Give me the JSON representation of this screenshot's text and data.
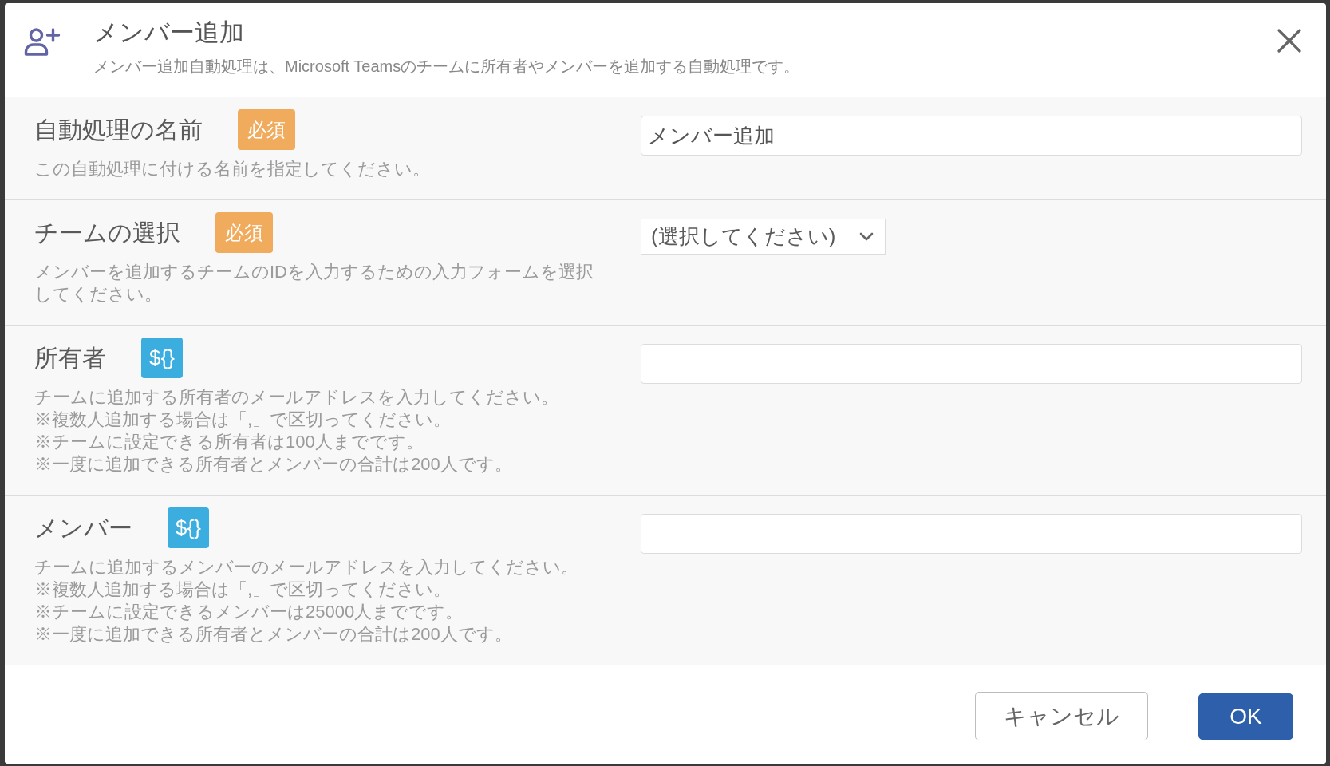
{
  "dialog": {
    "title": "メンバー追加",
    "description": "メンバー追加自動処理は、Microsoft Teamsのチームに所有者やメンバーを追加する自動処理です。"
  },
  "fields": [
    {
      "label": "自動処理の名前",
      "badge": {
        "kind": "required",
        "text": "必須"
      },
      "help": "この自動処理に付ける名前を指定してください。",
      "control": {
        "kind": "text",
        "value": "メンバー追加"
      }
    },
    {
      "label": "チームの選択",
      "badge": {
        "kind": "required",
        "text": "必須"
      },
      "help": "メンバーを追加するチームのIDを入力するための入力フォームを選択してください。",
      "control": {
        "kind": "select",
        "value": "(選択してください)"
      }
    },
    {
      "label": "所有者",
      "badge": {
        "kind": "variable",
        "text": "${}"
      },
      "help": "チームに追加する所有者のメールアドレスを入力してください。\n※複数人追加する場合は「,」で区切ってください。\n※チームに設定できる所有者は100人までです。\n※一度に追加できる所有者とメンバーの合計は200人です。",
      "control": {
        "kind": "text"
      }
    },
    {
      "label": "メンバー",
      "badge": {
        "kind": "variable",
        "text": "${}"
      },
      "help": "チームに追加するメンバーのメールアドレスを入力してください。\n※複数人追加する場合は「,」で区切ってください。\n※チームに設定できるメンバーは25000人までです。\n※一度に追加できる所有者とメンバーの合計は200人です。",
      "control": {
        "kind": "text"
      }
    }
  ],
  "buttons": [
    {
      "label": "キャンセル",
      "kind": "secondary"
    },
    {
      "label": "OK",
      "kind": "primary"
    }
  ]
}
